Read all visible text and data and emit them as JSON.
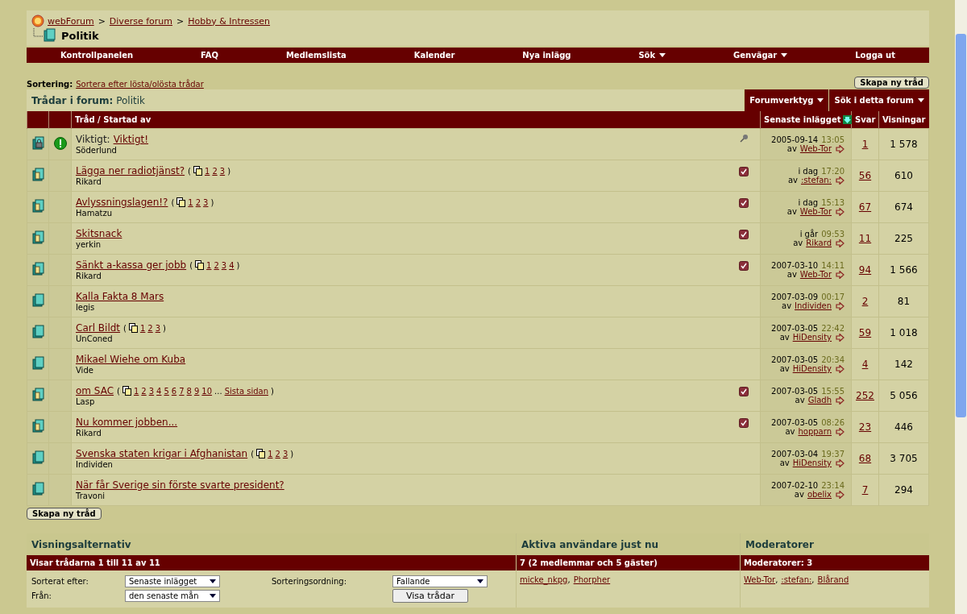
{
  "breadcrumb": [
    {
      "label": "webForum"
    },
    {
      "sep": ">",
      "label": "Diverse forum"
    },
    {
      "sep": ">",
      "label": "Hobby & Intressen"
    }
  ],
  "forum_title": "Politik",
  "nav": [
    {
      "label": "Kontrollpanelen",
      "menu": false
    },
    {
      "label": "FAQ",
      "menu": false
    },
    {
      "label": "Medlemslista",
      "menu": false
    },
    {
      "label": "Kalender",
      "menu": false
    },
    {
      "label": "Nya inlägg",
      "menu": false
    },
    {
      "label": "Sök",
      "menu": true
    },
    {
      "label": "Genvägar",
      "menu": true
    },
    {
      "label": "Logga ut",
      "menu": false
    }
  ],
  "sorting": {
    "label": "Sortering:",
    "link": "Sortera efter lösta/olösta trådar"
  },
  "top_new_thread_button": "Skapa ny tråd",
  "threads_header": {
    "title": "Trådar i forum:",
    "forum": "Politik",
    "tools": [
      {
        "label": "Forumverktyg"
      },
      {
        "label": "Sök i detta forum"
      }
    ]
  },
  "columns": {
    "thread": "Tråd / Startad av",
    "last_post": "Senaste inlägget",
    "replies": "Svar",
    "views": "Visningar"
  },
  "threads": [
    {
      "kind": "locked",
      "important": true,
      "prefix": "Viktigt:",
      "title": "Viktigt!",
      "author": "Söderlund",
      "sticky": true,
      "subscribed": false,
      "date": "2005-09-14",
      "time": "13:05",
      "by_label": "av",
      "by": "Web-Tor",
      "replies": "1",
      "views": "1 578"
    },
    {
      "kind": "hot",
      "important": false,
      "title": "Lägga ner radiotjänst?",
      "author": "Rikard",
      "pages": {
        "open": "(",
        "numbers": [
          "1",
          "2",
          "3"
        ],
        "close": ")"
      },
      "sticky": false,
      "subscribed": true,
      "date": "i dag",
      "time": "17:20",
      "by_label": "av",
      "by": ":stefan:",
      "replies": "56",
      "views": "610"
    },
    {
      "kind": "hot",
      "important": false,
      "title": "Avlyssningslagen!?",
      "author": "Hamatzu",
      "pages": {
        "open": "(",
        "numbers": [
          "1",
          "2",
          "3"
        ],
        "close": ")"
      },
      "sticky": false,
      "subscribed": true,
      "date": "i dag",
      "time": "15:13",
      "by_label": "av",
      "by": "Web-Tor",
      "replies": "67",
      "views": "674"
    },
    {
      "kind": "hot",
      "important": false,
      "title": "Skitsnack",
      "author": "yerkin",
      "sticky": false,
      "subscribed": true,
      "date": "i går",
      "time": "09:53",
      "by_label": "av",
      "by": "Rikard",
      "replies": "11",
      "views": "225"
    },
    {
      "kind": "hot",
      "important": false,
      "title": "Sänkt a-kassa ger jobb",
      "author": "Rikard",
      "pages": {
        "open": "(",
        "numbers": [
          "1",
          "2",
          "3",
          "4"
        ],
        "close": ")"
      },
      "sticky": false,
      "subscribed": true,
      "date": "2007-03-10",
      "time": "14:11",
      "by_label": "av",
      "by": "Web-Tor",
      "replies": "94",
      "views": "1 566"
    },
    {
      "kind": "normal",
      "important": false,
      "title": "Kalla Fakta 8 Mars",
      "author": "legis",
      "sticky": false,
      "subscribed": false,
      "date": "2007-03-09",
      "time": "00:17",
      "by_label": "av",
      "by": "Individen",
      "replies": "2",
      "views": "81"
    },
    {
      "kind": "normal",
      "important": false,
      "title": "Carl Bildt",
      "author": "UnConed",
      "pages": {
        "open": "(",
        "numbers": [
          "1",
          "2",
          "3"
        ],
        "close": ")"
      },
      "sticky": false,
      "subscribed": false,
      "date": "2007-03-05",
      "time": "22:42",
      "by_label": "av",
      "by": "HiDensity",
      "replies": "59",
      "views": "1 018"
    },
    {
      "kind": "normal",
      "important": false,
      "title": "Mikael Wiehe om Kuba",
      "author": "Vide",
      "sticky": false,
      "subscribed": false,
      "date": "2007-03-05",
      "time": "20:34",
      "by_label": "av",
      "by": "HiDensity",
      "replies": "4",
      "views": "142"
    },
    {
      "kind": "hot",
      "important": false,
      "title": "om SAC",
      "author": "Lasp",
      "pages": {
        "open": "(",
        "numbers": [
          "1",
          "2",
          "3",
          "4",
          "5",
          "6",
          "7",
          "8",
          "9",
          "10"
        ],
        "ellipsis": "...",
        "last": "Sista sidan",
        "close": ")"
      },
      "sticky": false,
      "subscribed": true,
      "date": "2007-03-05",
      "time": "15:55",
      "by_label": "av",
      "by": "Gladh",
      "replies": "252",
      "views": "5 056"
    },
    {
      "kind": "hot",
      "important": false,
      "title": "Nu kommer jobben...",
      "author": "Rikard",
      "sticky": false,
      "subscribed": true,
      "date": "2007-03-05",
      "time": "08:26",
      "by_label": "av",
      "by": "hopparn",
      "replies": "23",
      "views": "446"
    },
    {
      "kind": "normal",
      "important": false,
      "title": "Svenska staten krigar i Afghanistan",
      "author": "Individen",
      "pages": {
        "open": "(",
        "numbers": [
          "1",
          "2",
          "3"
        ],
        "close": ")"
      },
      "sticky": false,
      "subscribed": false,
      "date": "2007-03-04",
      "time": "19:37",
      "by_label": "av",
      "by": "HiDensity",
      "replies": "68",
      "views": "3 705"
    },
    {
      "kind": "normal",
      "important": false,
      "title": "När får Sverige sin förste svarte president?",
      "author": "Travoni",
      "sticky": false,
      "subscribed": false,
      "date": "2007-02-10",
      "time": "23:14",
      "by_label": "av",
      "by": "obelix",
      "replies": "7",
      "views": "294"
    }
  ],
  "bottom_new_thread_button": "Skapa ny tråd",
  "bottom": {
    "options": {
      "title": "Visningsalternativ",
      "bar": "Visar trådarna 1 till 11 av 11",
      "sorted_label": "Sorterat efter:",
      "sorted_value": "Senaste inlägget",
      "from_label": "Från:",
      "from_value": "den senaste mån",
      "order_label": "Sorteringsordning:",
      "order_value": "Fallande",
      "show_button": "Visa trådar"
    },
    "active": {
      "title": "Aktiva användare just nu",
      "bar": "7 (2 medlemmar och 5 gäster)",
      "users": [
        {
          "name": "micke_nkpg",
          "sep": ","
        },
        {
          "name": "Phorpher"
        }
      ]
    },
    "moderators": {
      "title": "Moderatorer",
      "bar": "Moderatorer: 3",
      "users": [
        {
          "name": "Web-Tor",
          "sep": ","
        },
        {
          "name": ":stefan:",
          "sep": ","
        },
        {
          "name": "Blårand"
        }
      ]
    }
  }
}
